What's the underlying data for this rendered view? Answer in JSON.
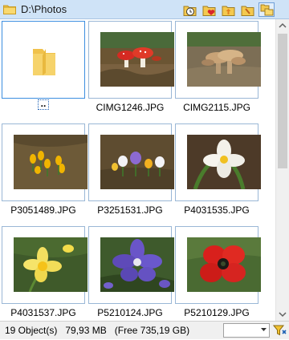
{
  "title_bar": {
    "path": "D:\\Photos",
    "toolbar_icons": [
      "clock-icon",
      "favorites-folder-icon",
      "folder-up-icon",
      "folder-root-icon",
      "copy-folder-icon"
    ]
  },
  "items": [
    {
      "label": "..",
      "type": "parent-folder",
      "selected": true
    },
    {
      "label": "CIMG1246.JPG",
      "type": "image",
      "subject": "red mushrooms"
    },
    {
      "label": "CIMG2115.JPG",
      "type": "image",
      "subject": "brown mushrooms"
    },
    {
      "label": "P3051489.JPG",
      "type": "image",
      "subject": "yellow crocuses"
    },
    {
      "label": "P3251531.JPG",
      "type": "image",
      "subject": "white and purple crocuses"
    },
    {
      "label": "P4031535.JPG",
      "type": "image",
      "subject": "white tulip"
    },
    {
      "label": "P4031537.JPG",
      "type": "image",
      "subject": "yellow daffodil"
    },
    {
      "label": "P5210124.JPG",
      "type": "image",
      "subject": "purple clematis"
    },
    {
      "label": "P5210129.JPG",
      "type": "image",
      "subject": "red poppy"
    }
  ],
  "status": {
    "object_count": "19 Object(s)",
    "size": "79,93 MB",
    "free": "(Free 735,19 GB)",
    "filter_value": "",
    "filter_button_icon": "filter-icon"
  },
  "colors": {
    "titlebar_bg": "#cfe3f7",
    "thumb_border": "#9ab7d6",
    "selection_border": "#3c8ee0",
    "folder_yellow": "#f6d36b"
  }
}
